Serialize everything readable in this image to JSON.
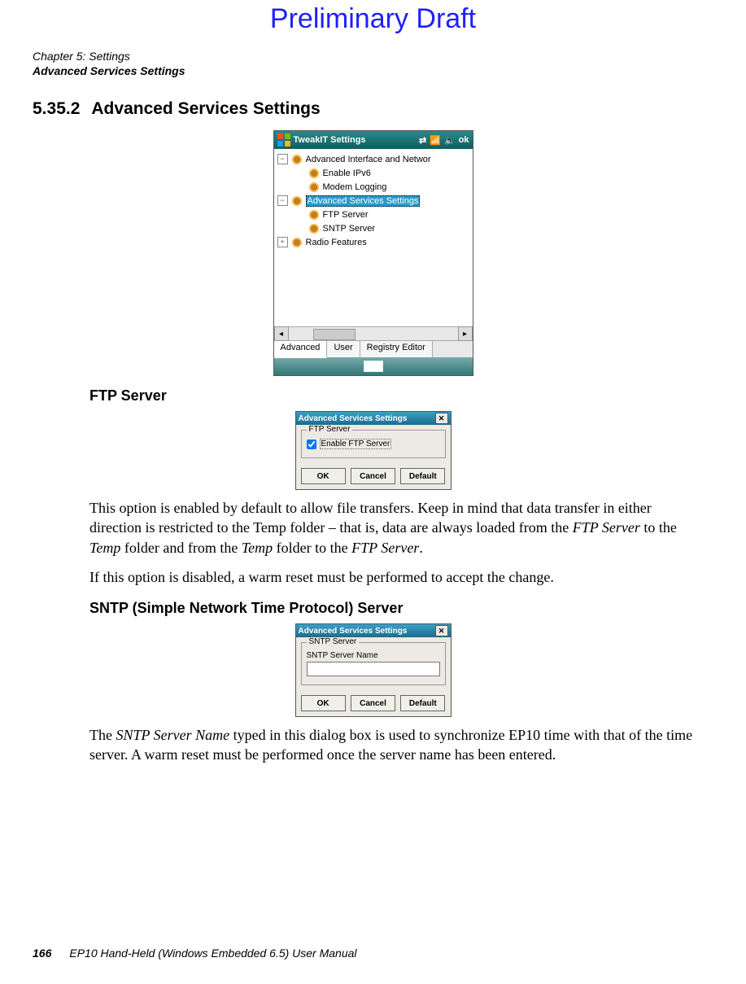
{
  "watermark": "Preliminary Draft",
  "chapter_line1": "Chapter 5: Settings",
  "chapter_line2": "Advanced Services Settings",
  "section": {
    "number": "5.35.2",
    "title": "Advanced Services Settings"
  },
  "tweakit": {
    "title": "TweakIT Settings",
    "ok": "ok",
    "tree": {
      "n0": "Advanced Interface and Networ",
      "n1": "Enable IPv6",
      "n2": "Modem Logging",
      "n3": "Advanced Services Settings",
      "n4": "FTP Server",
      "n5": "SNTP Server",
      "n6": "Radio Features"
    },
    "tabs": {
      "advanced": "Advanced",
      "user": "User",
      "registry": "Registry Editor"
    }
  },
  "ftp": {
    "heading": "FTP Server",
    "dialog_title": "Advanced Services Settings",
    "legend": "FTP Server",
    "checkbox_label": "Enable FTP Server",
    "btn_ok": "OK",
    "btn_cancel": "Cancel",
    "btn_default": "Default",
    "para1_a": "This option is enabled by default to allow file transfers. Keep in mind that data transfer in either direction is restricted to the Temp folder – that is, data are always loaded from the ",
    "para1_b": "FTP Server",
    "para1_c": " to the ",
    "para1_d": "Temp",
    "para1_e": " folder and from the ",
    "para1_f": "Temp",
    "para1_g": " folder to the ",
    "para1_h": "FTP Server",
    "para1_i": ".",
    "para2": "If this option is disabled, a warm reset must be performed to accept the change."
  },
  "sntp": {
    "heading": "SNTP (Simple Network Time Protocol) Server",
    "dialog_title": "Advanced Services Settings",
    "legend": "SNTP Server",
    "field_label": "SNTP Server Name",
    "btn_ok": "OK",
    "btn_cancel": "Cancel",
    "btn_default": "Default",
    "para_a": "The ",
    "para_b": "SNTP Server Name",
    "para_c": " typed in this dialog box is used to synchronize EP10 time with that of the time server. A warm reset must be performed once the server name has been entered."
  },
  "footer": {
    "pageno": "166",
    "manual": "EP10 Hand-Held (Windows Embedded 6.5) User Manual"
  }
}
